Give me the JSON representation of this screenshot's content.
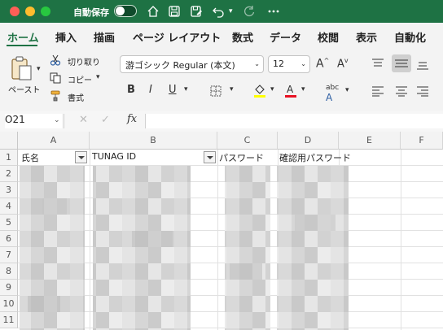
{
  "titlebar": {
    "autosave_label": "自動保存",
    "autosave_on": false,
    "icons": [
      "home-icon",
      "save-icon",
      "save-as-icon",
      "undo-icon",
      "redo-icon",
      "more-icon"
    ]
  },
  "ribbon_tabs": [
    "ホーム",
    "挿入",
    "描画",
    "ページ レイアウト",
    "数式",
    "データ",
    "校閲",
    "表示",
    "自動化"
  ],
  "active_tab": "ホーム",
  "clipboard": {
    "paste_label": "ペースト",
    "cut_label": "切り取り",
    "copy_label": "コピー",
    "format_label": "書式"
  },
  "font": {
    "name": "游ゴシック Regular (本文)",
    "size": "12"
  },
  "formula_bar": {
    "name_box": "O21",
    "fx_label": "fx",
    "value": ""
  },
  "columns": [
    "A",
    "B",
    "C",
    "D",
    "E",
    "F"
  ],
  "rows": [
    "1",
    "2",
    "3",
    "4",
    "5",
    "6",
    "7",
    "8",
    "9",
    "10",
    "11"
  ],
  "headers": {
    "a1": "氏名",
    "b1": "TUNAG ID",
    "c1": "パスワード",
    "d1": "確認用パスワード"
  },
  "colors": {
    "titlebar": "#1e7244",
    "active_tab": "#1e7244",
    "grid_line": "#e1e1e1"
  }
}
